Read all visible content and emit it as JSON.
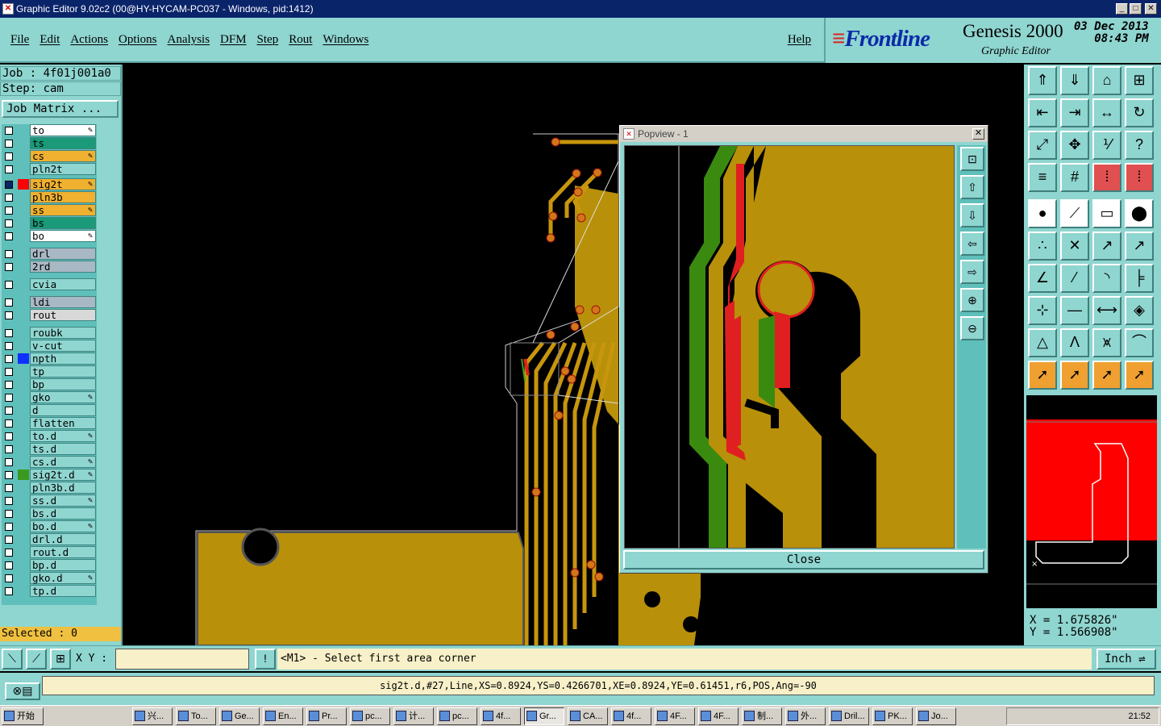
{
  "window": {
    "title": "Graphic Editor 9.02c2 (00@HY-HYCAM-PC037 - Windows, pid:1412)"
  },
  "menu": [
    "File",
    "Edit",
    "Actions",
    "Options",
    "Analysis",
    "DFM",
    "Step",
    "Rout",
    "Windows"
  ],
  "help": "Help",
  "brand": {
    "logo": "Frontline",
    "product": "Genesis 2000",
    "subtitle": "Graphic Editor",
    "date": "03 Dec 2013",
    "time": "08:43 PM"
  },
  "job": {
    "job": "Job : 4f01j001a0",
    "step": "Step: cam",
    "matrix": "Job Matrix ..."
  },
  "layers": [
    {
      "name": "to",
      "color": "#ffffff",
      "swatch": "",
      "edit": true
    },
    {
      "name": "ts",
      "color": "#1a9a78",
      "swatch": "",
      "edit": false
    },
    {
      "name": "cs",
      "color": "#f0b030",
      "swatch": "",
      "edit": true
    },
    {
      "name": "pln2t",
      "color": "#8fd5d0",
      "swatch": "",
      "edit": false
    },
    {
      "name": "sig2t",
      "color": "#f0b030",
      "swatch": "#ff0000",
      "edit": true,
      "active": true
    },
    {
      "name": "pln3b",
      "color": "#f0b030",
      "swatch": "",
      "edit": false
    },
    {
      "name": "ss",
      "color": "#f0b030",
      "swatch": "",
      "edit": true
    },
    {
      "name": "bs",
      "color": "#1a9a78",
      "swatch": "",
      "edit": false
    },
    {
      "name": "bo",
      "color": "#ffffff",
      "swatch": "",
      "edit": true
    },
    {
      "name": "drl",
      "color": "#a8b8c4",
      "swatch": "",
      "edit": false
    },
    {
      "name": "2rd",
      "color": "#a8b8c4",
      "swatch": "",
      "edit": false
    },
    {
      "name": "cvia",
      "color": "#8fd5d0",
      "swatch": "",
      "edit": false
    },
    {
      "name": "ldi",
      "color": "#a8b8c4",
      "swatch": "",
      "edit": false
    },
    {
      "name": "rout",
      "color": "#d8d8d8",
      "swatch": "",
      "edit": false
    },
    {
      "name": "roubk",
      "color": "#8fd5d0",
      "swatch": "",
      "edit": false
    },
    {
      "name": "v-cut",
      "color": "#8fd5d0",
      "swatch": "",
      "edit": false
    },
    {
      "name": "npth",
      "color": "#8fd5d0",
      "swatch": "#1030ff",
      "edit": false
    },
    {
      "name": "tp",
      "color": "#8fd5d0",
      "swatch": "",
      "edit": false
    },
    {
      "name": "bp",
      "color": "#8fd5d0",
      "swatch": "",
      "edit": false
    },
    {
      "name": "gko",
      "color": "#8fd5d0",
      "swatch": "",
      "edit": true
    },
    {
      "name": "d",
      "color": "#8fd5d0",
      "swatch": "",
      "edit": false
    },
    {
      "name": "flatten",
      "color": "#8fd5d0",
      "swatch": "",
      "edit": false
    },
    {
      "name": "to.d",
      "color": "#8fd5d0",
      "swatch": "",
      "edit": true
    },
    {
      "name": "ts.d",
      "color": "#8fd5d0",
      "swatch": "",
      "edit": false
    },
    {
      "name": "cs.d",
      "color": "#8fd5d0",
      "swatch": "",
      "edit": true
    },
    {
      "name": "sig2t.d",
      "color": "#8fd5d0",
      "swatch": "#3a9a20",
      "edit": true
    },
    {
      "name": "pln3b.d",
      "color": "#8fd5d0",
      "swatch": "",
      "edit": false
    },
    {
      "name": "ss.d",
      "color": "#8fd5d0",
      "swatch": "",
      "edit": true
    },
    {
      "name": "bs.d",
      "color": "#8fd5d0",
      "swatch": "",
      "edit": false
    },
    {
      "name": "bo.d",
      "color": "#8fd5d0",
      "swatch": "",
      "edit": true
    },
    {
      "name": "drl.d",
      "color": "#8fd5d0",
      "swatch": "",
      "edit": false
    },
    {
      "name": "rout.d",
      "color": "#8fd5d0",
      "swatch": "",
      "edit": false
    },
    {
      "name": "bp.d",
      "color": "#8fd5d0",
      "swatch": "",
      "edit": false
    },
    {
      "name": "gko.d",
      "color": "#8fd5d0",
      "swatch": "",
      "edit": true
    },
    {
      "name": "tp.d",
      "color": "#8fd5d0",
      "swatch": "",
      "edit": false
    }
  ],
  "selected": "Selected : 0",
  "popup": {
    "title": "Popview - 1",
    "close": "Close"
  },
  "coords": {
    "x": "X = 1.675826\"",
    "y": "Y = 1.566908\""
  },
  "cmd": {
    "xy_label": "X Y :",
    "prompt": "<M1> - Select first area corner",
    "units": "Inch"
  },
  "status": "sig2t.d,#27,Line,XS=0.8924,YS=0.4266701,XE=0.8924,YE=0.61451,r6,POS,Ang=-90",
  "taskbar": {
    "start": "开始",
    "items": [
      "兴...",
      "To...",
      "Ge...",
      "En...",
      "Pr...",
      "pc...",
      "计...",
      "pc...",
      "4f...",
      "Gr...",
      "CA...",
      "4f...",
      "4F...",
      "4F...",
      "制...",
      "外...",
      "Dril...",
      "PK...",
      "Jo..."
    ],
    "active": 9,
    "clock": "21:52"
  }
}
